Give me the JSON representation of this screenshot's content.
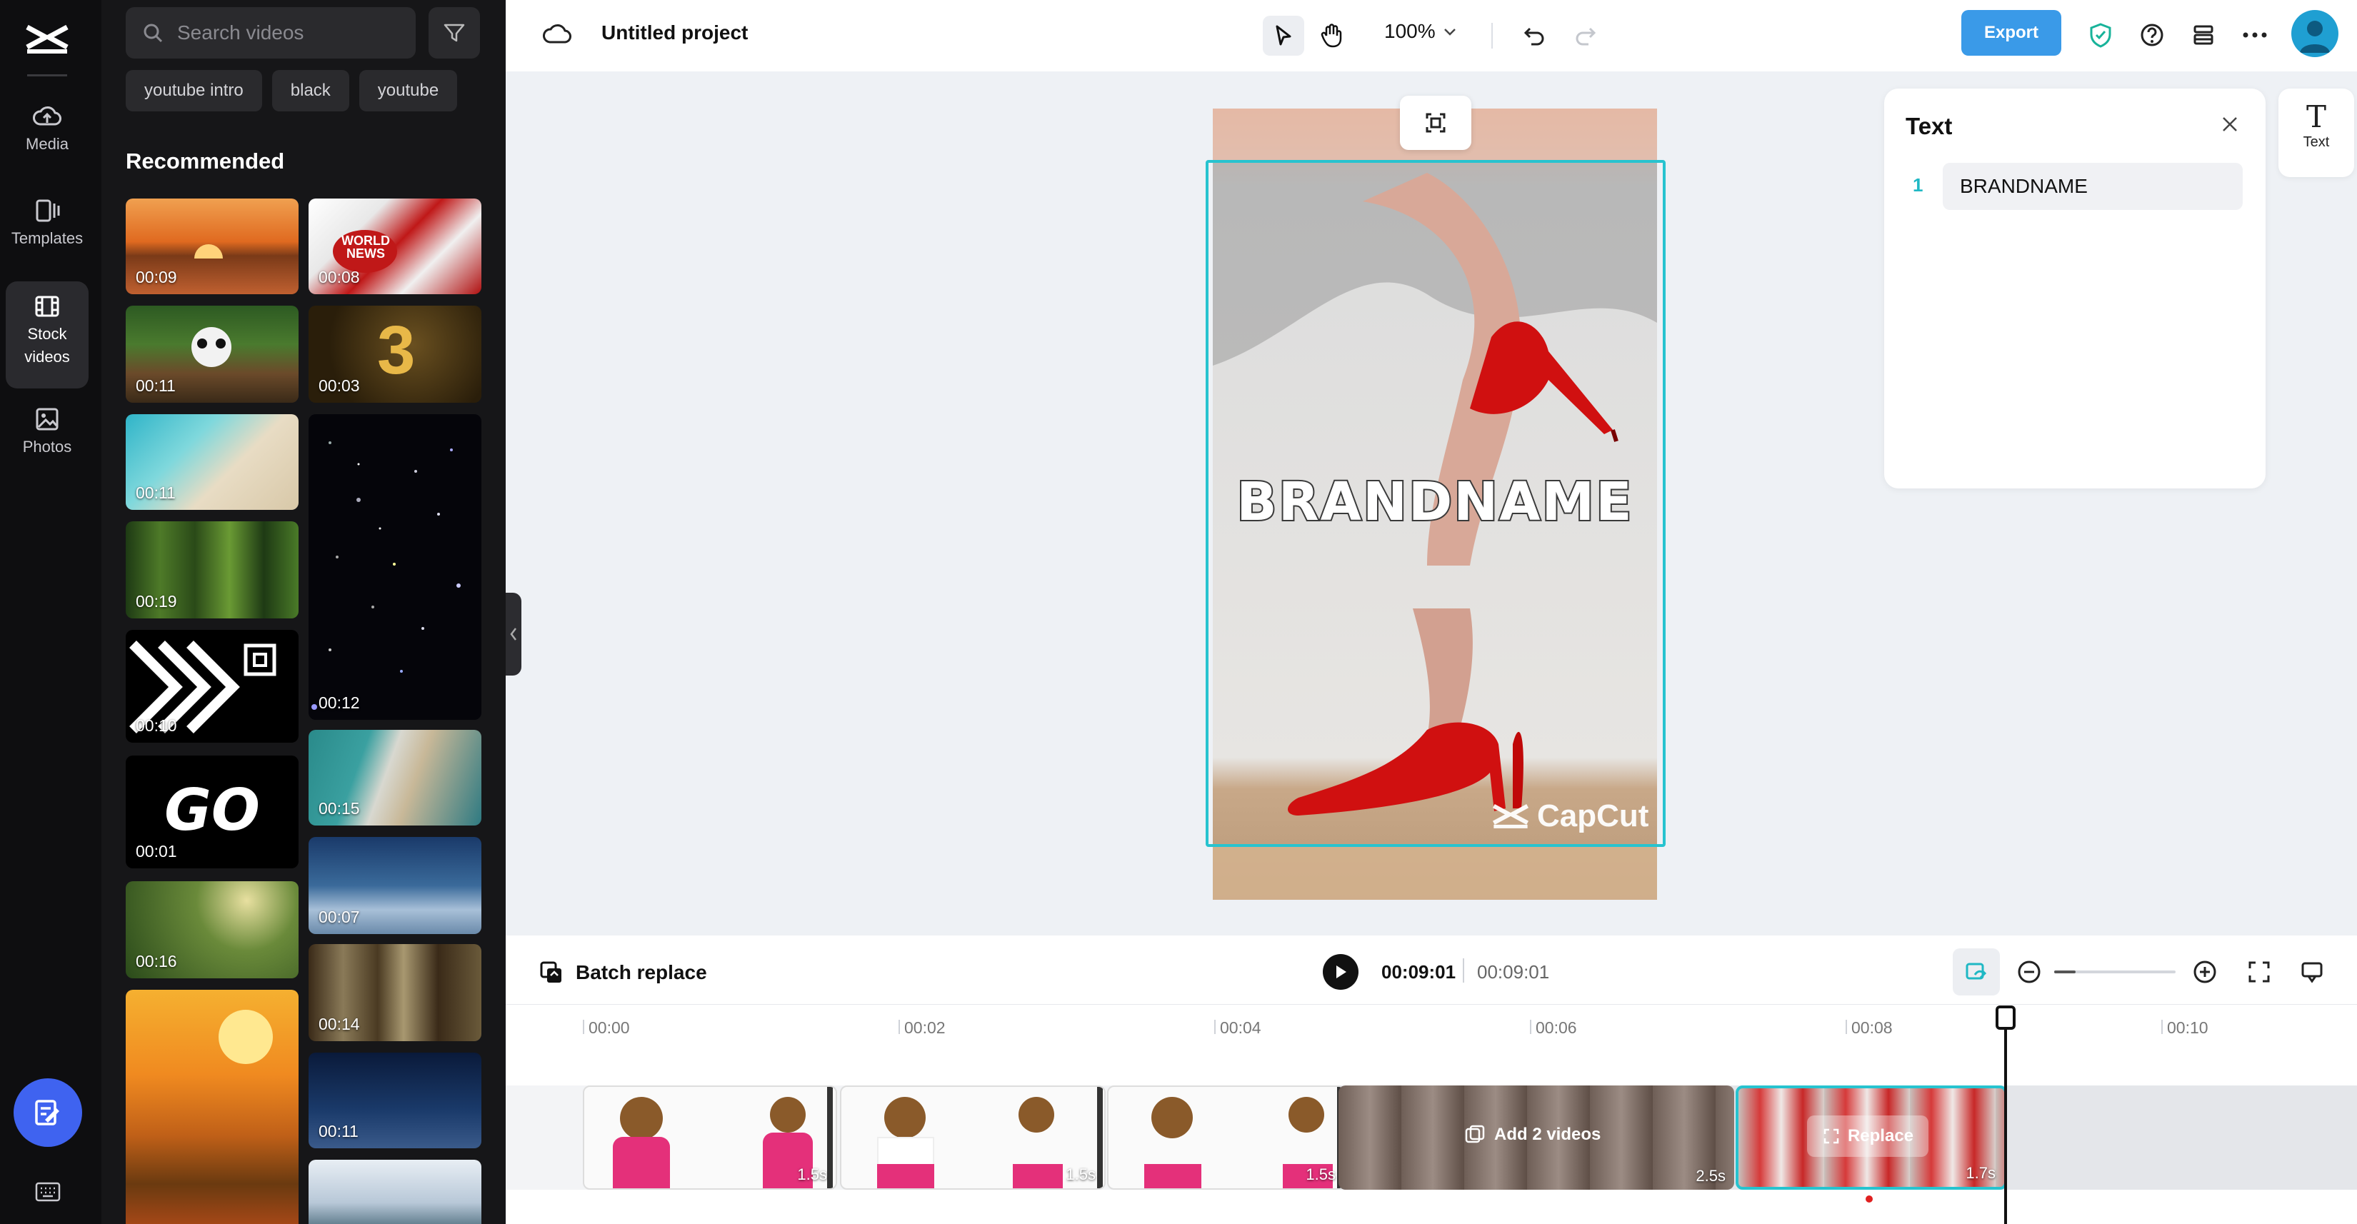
{
  "rail": {
    "items": [
      {
        "label": "Media",
        "icon": "cloud-upload-icon"
      },
      {
        "label": "Templates",
        "icon": "templates-icon"
      },
      {
        "label": "Stock\nvideos",
        "icon": "film-icon",
        "active": true
      },
      {
        "label": "Photos",
        "icon": "image-icon"
      }
    ]
  },
  "panel": {
    "search_placeholder": "Search videos",
    "tags": [
      "youtube intro",
      "black",
      "youtube"
    ],
    "recommended": "Recommended",
    "left_column": [
      {
        "duration": "00:09"
      },
      {
        "duration": "00:11"
      },
      {
        "duration": "00:11"
      },
      {
        "duration": "00:19"
      },
      {
        "duration": "00:10"
      },
      {
        "duration": "00:01",
        "text": "GO"
      },
      {
        "duration": "00:16"
      },
      {
        "duration": ""
      }
    ],
    "right_column": [
      {
        "duration": "00:08",
        "text": "WORLD NEWS"
      },
      {
        "duration": "00:03",
        "text": "3"
      },
      {
        "duration": "00:12"
      },
      {
        "duration": "00:15"
      },
      {
        "duration": "00:07"
      },
      {
        "duration": "00:14"
      },
      {
        "duration": "00:11"
      },
      {
        "duration": ""
      }
    ]
  },
  "topbar": {
    "project_name": "Untitled project",
    "zoom": "100%",
    "export_label": "Export"
  },
  "canvas": {
    "overlay_text": "BRANDNAME",
    "watermark": "CapCut"
  },
  "text_panel": {
    "title": "Text",
    "entries": [
      {
        "index": "1",
        "value": "BRANDNAME"
      }
    ],
    "tab_label": "Text"
  },
  "timeline": {
    "batch_label": "Batch replace",
    "current_time": "00:09:01",
    "total_time": "00:09:01",
    "ruler": [
      "00:00",
      "00:02",
      "00:04",
      "00:06",
      "00:08",
      "00:10"
    ],
    "clips": [
      {
        "length": "1.5s"
      },
      {
        "length": "1.5s"
      },
      {
        "length": "1.5s"
      },
      {
        "length": "2.5s",
        "label": "Add 2 videos"
      },
      {
        "length": "1.7s",
        "label": "Replace"
      }
    ]
  },
  "colors": {
    "accent": "#3a9ae8",
    "selection": "#27c3cf",
    "fab": "#3f63f0"
  }
}
